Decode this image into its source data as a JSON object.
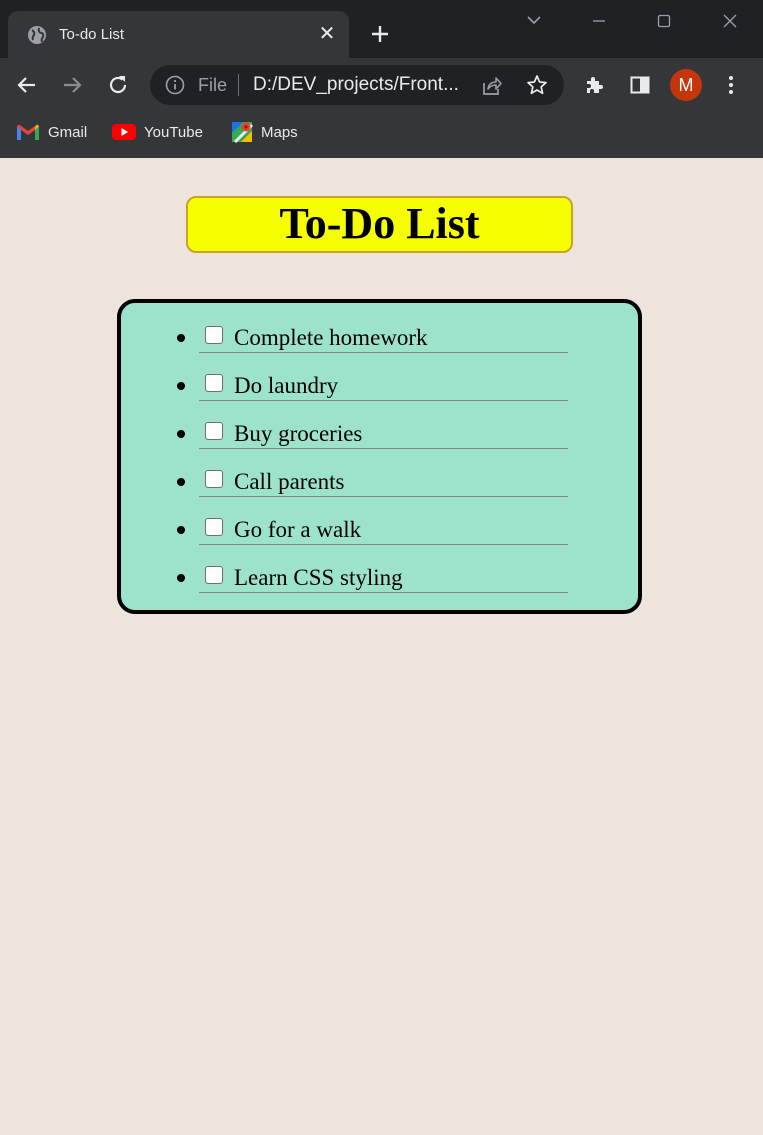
{
  "browser": {
    "tab": {
      "title": "To-do List",
      "icon": "globe-icon",
      "close_glyph": "✕"
    },
    "omnibox": {
      "scheme": "File",
      "url": "D:/DEV_projects/Front..."
    },
    "profile_initial": "M",
    "bookmarks": [
      {
        "label": "Gmail",
        "icon": "gmail-icon"
      },
      {
        "label": "YouTube",
        "icon": "youtube-icon"
      },
      {
        "label": "Maps",
        "icon": "maps-icon"
      }
    ]
  },
  "page": {
    "title": "To-Do List",
    "items": [
      {
        "label": "Complete homework",
        "checked": false
      },
      {
        "label": "Do laundry",
        "checked": false
      },
      {
        "label": "Buy groceries",
        "checked": false
      },
      {
        "label": "Call parents",
        "checked": false
      },
      {
        "label": "Go for a walk",
        "checked": false
      },
      {
        "label": "Learn CSS styling",
        "checked": false
      }
    ]
  },
  "colors": {
    "background": "#ede5dc",
    "title_bg": "#f6ff00",
    "list_bg": "#9de3cb",
    "avatar": "#c5360b"
  }
}
